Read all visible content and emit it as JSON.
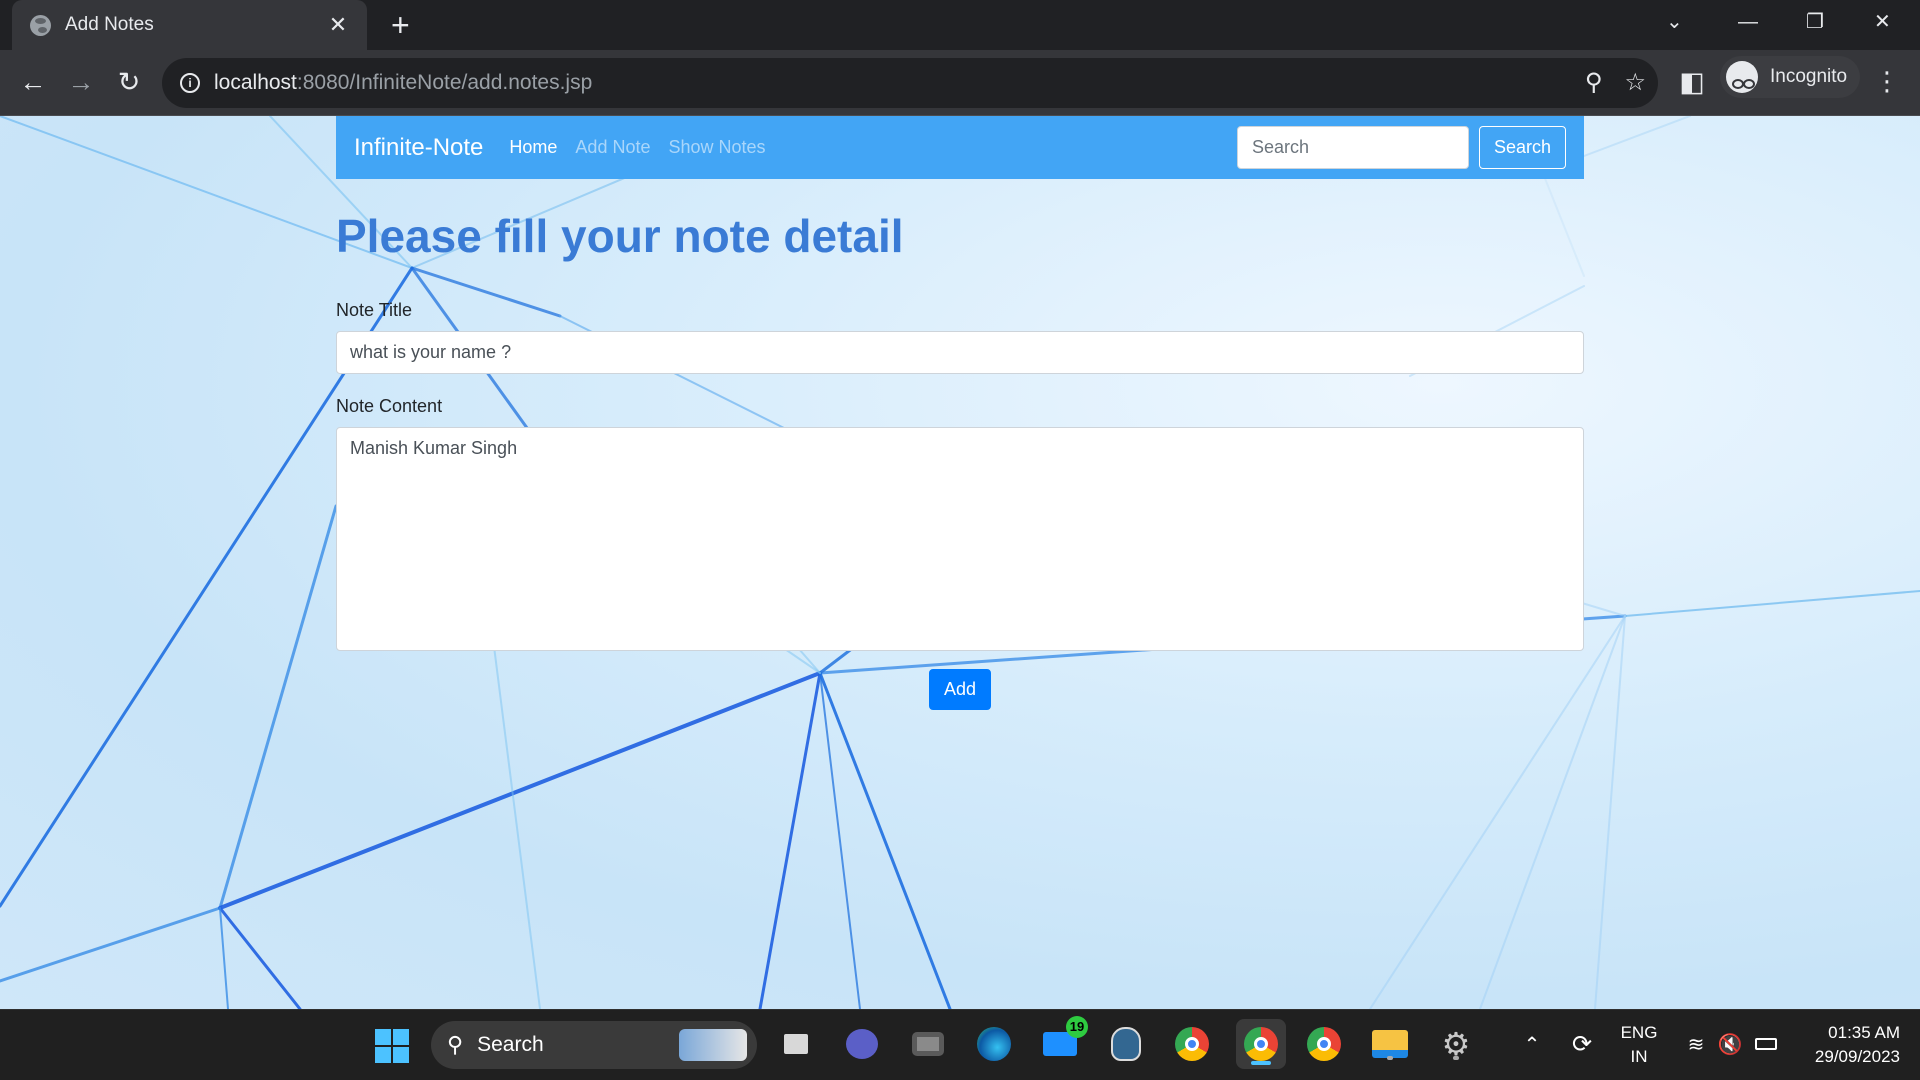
{
  "browser": {
    "tab_title": "Add Notes",
    "tab_close": "✕",
    "new_tab": "+",
    "url_host": "localhost",
    "url_rest": ":8080/InfiniteNote/add.notes.jsp",
    "profile_label": "Incognito",
    "window_controls": {
      "dropdown": "⌄",
      "minimize": "—",
      "restore": "❐",
      "close": "✕"
    }
  },
  "navbar": {
    "brand": "Infinite-Note",
    "links": [
      {
        "label": "Home",
        "active": true
      },
      {
        "label": "Add Note",
        "active": false
      },
      {
        "label": "Show Notes",
        "active": false
      }
    ],
    "search_placeholder": "Search",
    "search_button": "Search"
  },
  "form": {
    "heading": "Please fill your note detail",
    "title_label": "Note Title",
    "title_value": "what is your name ?",
    "content_label": "Note Content",
    "content_value": "Manish Kumar Singh",
    "submit_label": "Add"
  },
  "taskbar": {
    "search_label": "Search",
    "mail_badge": "19",
    "lang_top": "ENG",
    "lang_bottom": "IN",
    "time": "01:35 AM",
    "date": "29/09/2023",
    "apps": [
      "task-view-icon",
      "teams-icon",
      "camera-icon",
      "edge-icon",
      "mail-icon",
      "postgres-icon",
      "chrome-icon",
      "chrome-profile-icon",
      "chrome-alt-icon",
      "file-explorer-icon",
      "settings-icon"
    ]
  },
  "colors": {
    "navbar": "#42a5f5",
    "heading": "#3a7bd5",
    "primary_button": "#007bff",
    "chrome_dark": "#202124",
    "chrome_mid": "#35363a"
  }
}
